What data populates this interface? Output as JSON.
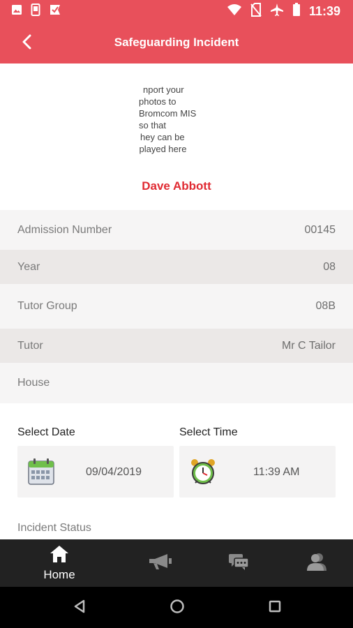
{
  "status_bar": {
    "time": "11:39",
    "icons": [
      "image-icon",
      "phone-icon",
      "check-flag-icon",
      "wifi-icon",
      "no-sim-icon",
      "airplane-icon",
      "battery-icon"
    ],
    "background": "#e8505b"
  },
  "app_bar": {
    "title": "Safeguarding Incident",
    "back_icon": "chevron-left-icon",
    "background": "#e8505b"
  },
  "photo_placeholder": {
    "lines": [
      "nport your",
      "photos to",
      "Bromcom MIS",
      "so that",
      "hey can be",
      "splayed here"
    ]
  },
  "student": {
    "name": "Dave Abbott",
    "name_color": "#e02a32"
  },
  "details": [
    {
      "label": "Admission Number",
      "value": "00145"
    },
    {
      "label": "Year",
      "value": "08"
    },
    {
      "label": "Tutor Group",
      "value": "08B"
    },
    {
      "label": "Tutor",
      "value": "Mr C Tailor"
    },
    {
      "label": "House",
      "value": ""
    }
  ],
  "date_picker": {
    "label": "Select Date",
    "value": "09/04/2019",
    "icon": "calendar-icon"
  },
  "time_picker": {
    "label": "Select Time",
    "value": "11:39 AM",
    "icon": "alarm-clock-icon"
  },
  "incident_status": {
    "label": "Incident Status"
  },
  "bottom_nav": {
    "items": [
      {
        "label": "Home",
        "icon": "home-icon"
      },
      {
        "label": "",
        "icon": "megaphone-icon"
      },
      {
        "label": "",
        "icon": "chat-icon"
      },
      {
        "label": "",
        "icon": "user-icon"
      }
    ]
  },
  "system_nav": {
    "icons": [
      "back-triangle-icon",
      "home-circle-icon",
      "recents-square-icon"
    ]
  }
}
